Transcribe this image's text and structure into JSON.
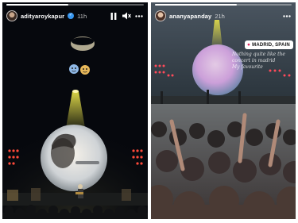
{
  "left_story": {
    "username": "adityaroykapur",
    "time": "11h",
    "verified": true,
    "progress": 0.45,
    "emojis": [
      "sparkles-face-emoji",
      "heart-eyes-face-emoji"
    ],
    "controls": [
      "pause-icon",
      "mute-icon",
      "more-icon"
    ]
  },
  "right_story": {
    "username": "ananyapanday",
    "time": "21h",
    "progress": 0.6,
    "location": "MADRID, SPAIN",
    "caption_lines": [
      "Nothing quite like the",
      "concert in madrid",
      "My favourite"
    ],
    "controls": [
      "more-icon"
    ]
  },
  "colors": {
    "stage_light_yellow": "#e6e04a",
    "stage_light_red": "#ff4a3a",
    "balloon_pink": "#d9a8e6",
    "verified_blue": "#3897f0",
    "pin_red": "#e0245e"
  }
}
